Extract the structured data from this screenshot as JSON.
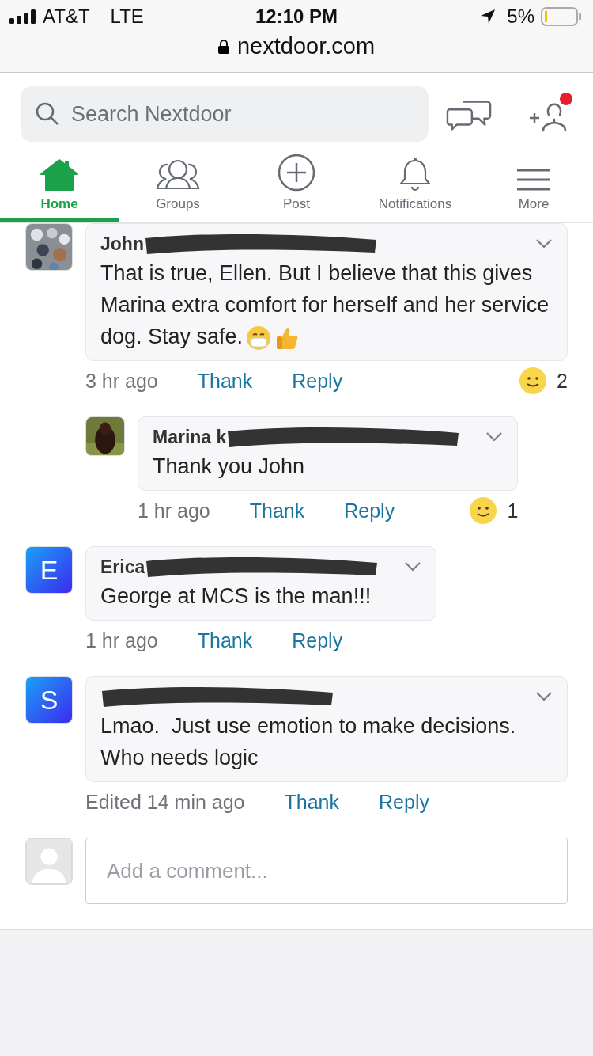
{
  "status_bar": {
    "carrier": "AT&T",
    "network": "LTE",
    "time": "12:10 PM",
    "battery": "5%"
  },
  "browser": {
    "url": "nextdoor.com"
  },
  "search": {
    "placeholder": "Search Nextdoor"
  },
  "header": {
    "notification_dot": true
  },
  "tabs": [
    {
      "label": "Home",
      "selected": true
    },
    {
      "label": "Groups",
      "selected": false
    },
    {
      "label": "Post",
      "selected": false
    },
    {
      "label": "Notifications",
      "selected": false
    },
    {
      "label": "More",
      "selected": false
    }
  ],
  "comments": [
    {
      "avatar": {
        "kind": "picture"
      },
      "author": "John",
      "redacted": true,
      "text": "That is true, Ellen. But I believe that this gives Marina extra comfort for herself and her service dog. Stay safe.",
      "kind": "with_emoji",
      "time": "3 hr ago",
      "actions": [
        "Thank",
        "Reply"
      ],
      "reactions": "2",
      "children": [
        {
          "avatar": {
            "kind": "picture"
          },
          "author": "Marina k",
          "redacted": true,
          "text": "Thank you John",
          "time": "1 hr ago",
          "actions": [
            "Thank",
            "Reply"
          ],
          "reactions": "1"
        }
      ]
    },
    {
      "avatar": {
        "kind": "letter",
        "letter": "E"
      },
      "author": "Erica",
      "redacted": true,
      "text": "George at MCS is the man!!!",
      "time": "1 hr ago",
      "actions": [
        "Thank",
        "Reply"
      ]
    },
    {
      "avatar": {
        "kind": "letter",
        "letter": "S"
      },
      "redacted": true,
      "text": "Lmao.  Just use emotion to make decisions. Who needs logic",
      "time": "Edited 14 min ago",
      "actions": [
        "Thank",
        "Reply"
      ]
    }
  ],
  "composer": {
    "placeholder": "Add a comment..."
  }
}
